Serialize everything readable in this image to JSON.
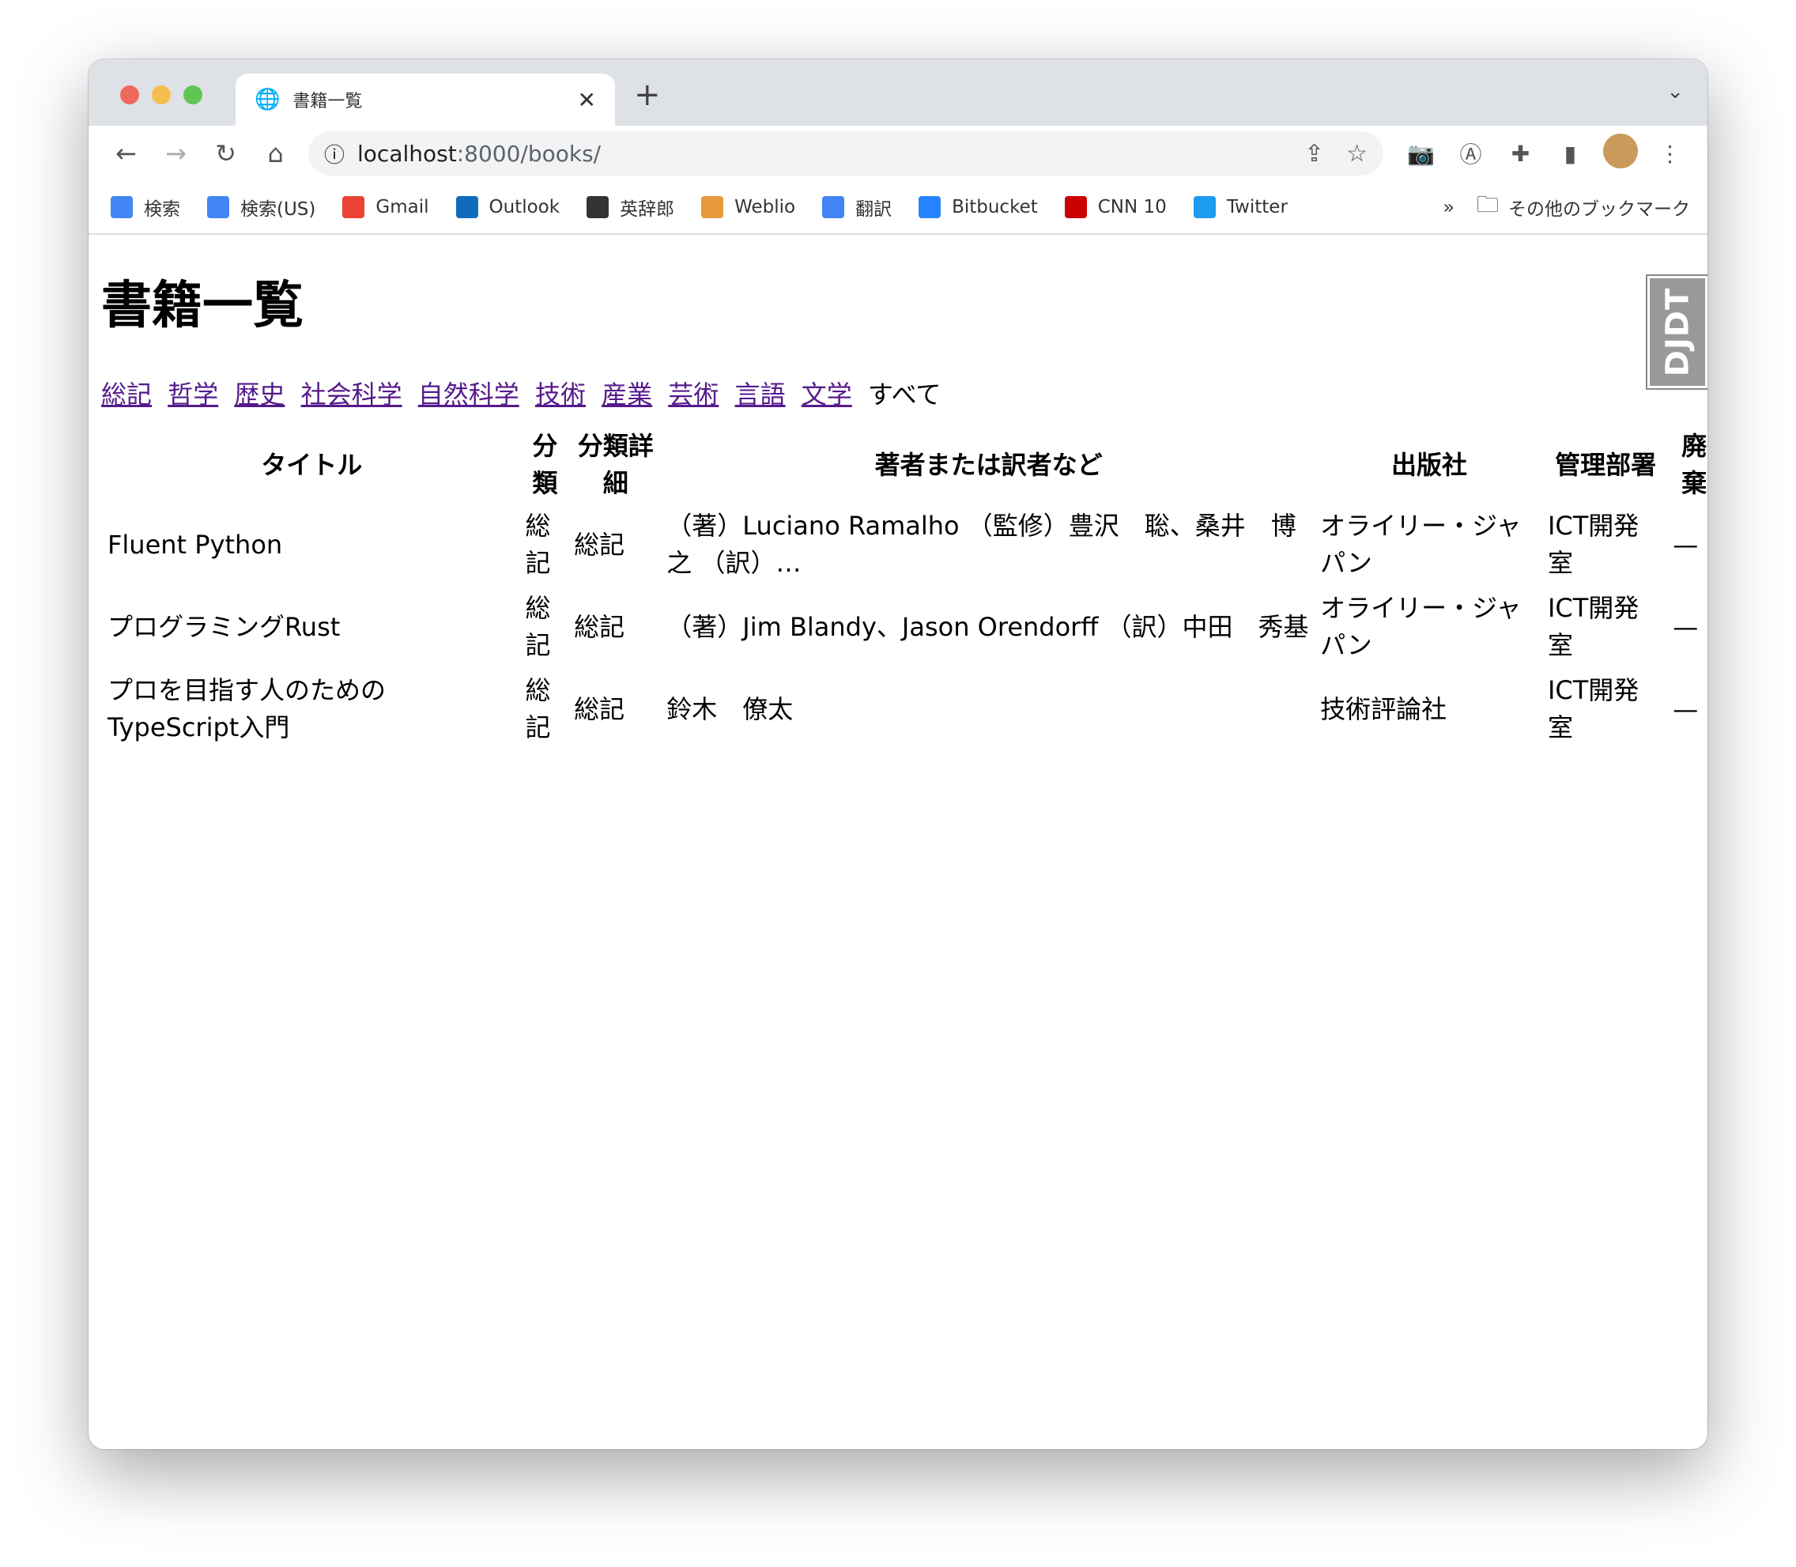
{
  "browser": {
    "tab_title": "書籍一覧",
    "url_host": "localhost",
    "url_rest": ":8000/books/",
    "bookmarks": [
      {
        "label": "検索",
        "icon": "google-icon",
        "color": "#4285f4"
      },
      {
        "label": "検索(US)",
        "icon": "google-icon",
        "color": "#4285f4"
      },
      {
        "label": "Gmail",
        "icon": "gmail-icon",
        "color": "#ea4335"
      },
      {
        "label": "Outlook",
        "icon": "outlook-icon",
        "color": "#0f6cbd"
      },
      {
        "label": "英辞郎",
        "icon": "eijiro-icon",
        "color": "#333333"
      },
      {
        "label": "Weblio",
        "icon": "weblio-icon",
        "color": "#e69a3c"
      },
      {
        "label": "翻訳",
        "icon": "translate-icon",
        "color": "#4285f4"
      },
      {
        "label": "Bitbucket",
        "icon": "bitbucket-icon",
        "color": "#2684ff"
      },
      {
        "label": "CNN 10",
        "icon": "cnn-icon",
        "color": "#cc0000"
      },
      {
        "label": "Twitter",
        "icon": "twitter-icon",
        "color": "#1d9bf0"
      }
    ],
    "more": "»",
    "other_bookmarks": "その他のブックマーク"
  },
  "page": {
    "title": "書籍一覧",
    "categories": [
      "総記",
      "哲学",
      "歴史",
      "社会科学",
      "自然科学",
      "技術",
      "産業",
      "芸術",
      "言語",
      "文学"
    ],
    "all_label": "すべて",
    "link_color": "#551a8b",
    "djdt": "DJDT"
  },
  "table": {
    "headers": [
      "タイトル",
      "分類",
      "分類詳細",
      "著者または訳者など",
      "出版社",
      "管理部署",
      "廃棄"
    ],
    "rows": [
      [
        "Fluent Python",
        "総記",
        "総記",
        "（著）Luciano Ramalho （監修）豊沢　聡、桑井　博之 （訳）…",
        "オライリー・ジャパン",
        "ICT開発室",
        "—"
      ],
      [
        "プログラミングRust",
        "総記",
        "総記",
        "（著）Jim Blandy、Jason Orendorff （訳）中田　秀基",
        "オライリー・ジャパン",
        "ICT開発室",
        "—"
      ],
      [
        "プロを目指す人のためのTypeScript入門",
        "総記",
        "総記",
        "鈴木　僚太",
        "技術評論社",
        "ICT開発室",
        "—"
      ]
    ]
  }
}
